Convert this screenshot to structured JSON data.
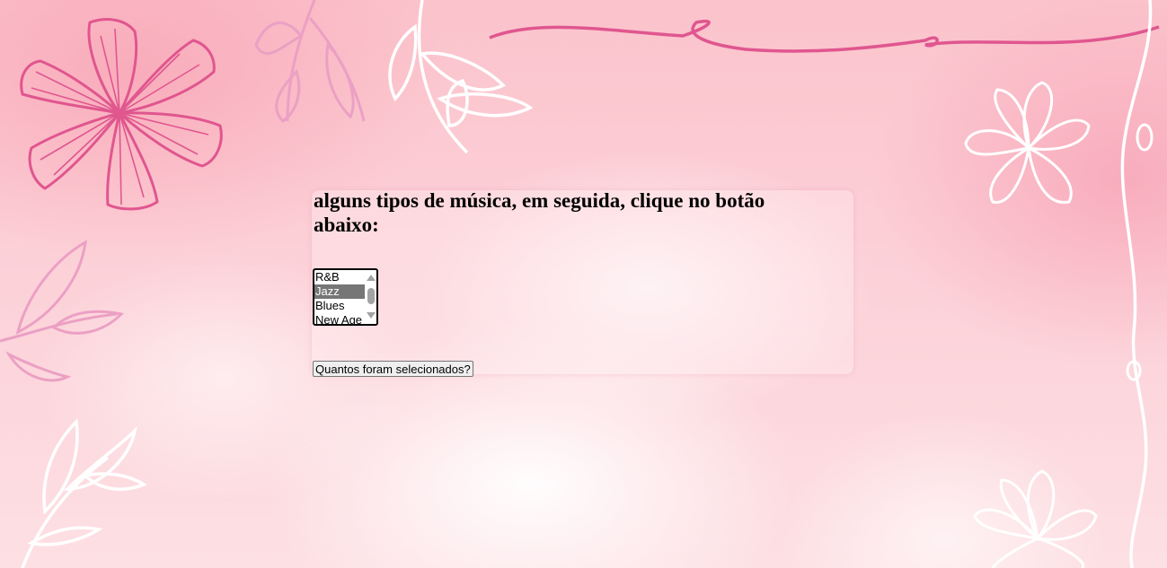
{
  "page": {
    "heading": "alguns tipos de música, em seguida, clique no botão abaixo:"
  },
  "music_select": {
    "options": [
      {
        "label": "R&B",
        "selected": false
      },
      {
        "label": "Jazz",
        "selected": true
      },
      {
        "label": "Blues",
        "selected": false
      },
      {
        "label": "New Age",
        "selected": false
      }
    ]
  },
  "count_button": {
    "label": "Quantos foram selecionados?"
  },
  "colors": {
    "accent_pink": "#e0568f",
    "light_pink": "#eba0c4",
    "background": "#fcd0d7",
    "selected_option": "#767676"
  }
}
